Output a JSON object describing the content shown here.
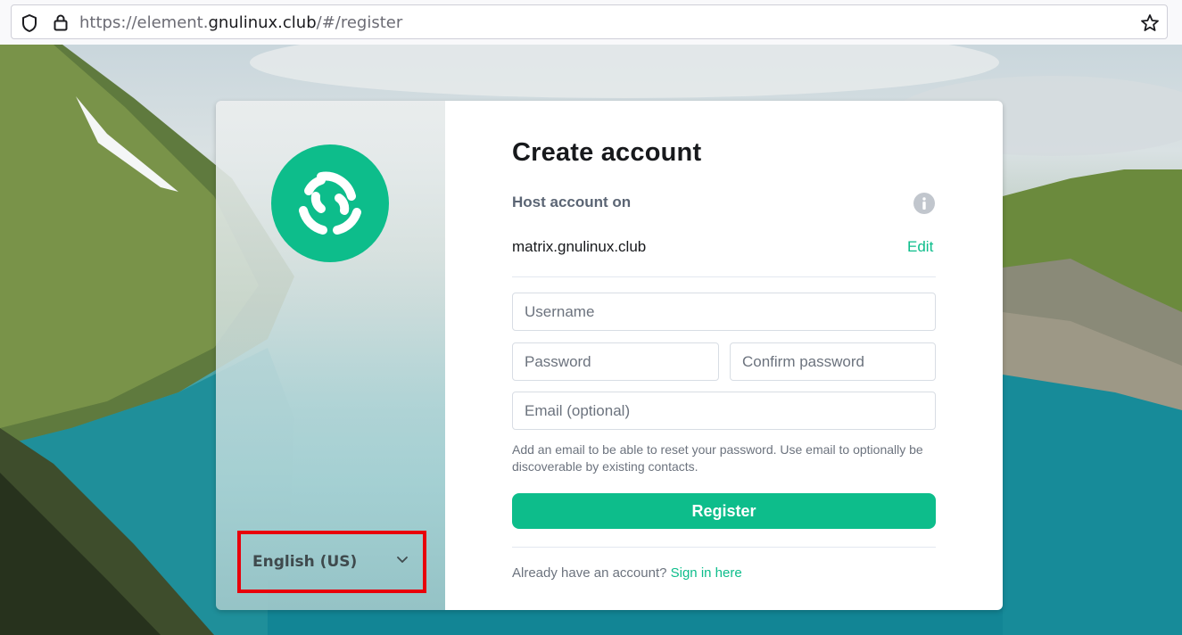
{
  "browser": {
    "url_prefix": "https://element.",
    "url_domain": "gnulinux.club",
    "url_suffix": "/#/register"
  },
  "brand": {
    "accent_color": "#0dbd8b",
    "logo_icon": "element-logo-icon"
  },
  "language": {
    "selected": "English (US)",
    "icon": "chevron-down-icon"
  },
  "form": {
    "title": "Create account",
    "host_label": "Host account on",
    "server_name": "matrix.gnulinux.club",
    "edit_label": "Edit",
    "username_placeholder": "Username",
    "password_placeholder": "Password",
    "confirm_placeholder": "Confirm password",
    "email_placeholder": "Email (optional)",
    "email_help": "Add an email to be able to reset your password. Use email to optionally be discoverable by existing contacts.",
    "register_label": "Register",
    "signin_prompt": "Already have an account?",
    "signin_link": "Sign in here"
  }
}
